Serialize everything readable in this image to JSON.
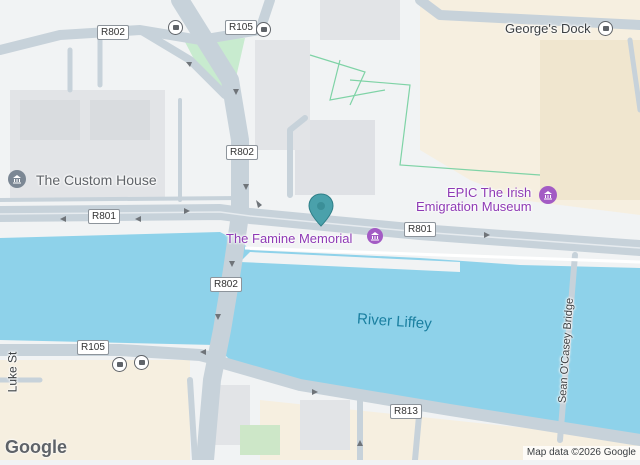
{
  "water": {
    "name": "River Liffey"
  },
  "places": {
    "custom_house": "The Custom House",
    "famine_memorial": "The Famine Memorial",
    "epic_line1": "EPIC The Irish",
    "epic_line2": "Emigration Museum",
    "georges_dock": "George's Dock"
  },
  "streets": {
    "luke_st": "Luke St",
    "sean_ocasey_bridge": "Sean O'Casey Bridge"
  },
  "shields": {
    "r105_top": "R105",
    "r802_top": "R802",
    "r802_mid": "R802",
    "r801_left": "R801",
    "r801_right": "R801",
    "r802_low": "R802",
    "r105_low": "R105",
    "r813": "R813"
  },
  "attribution": {
    "logo": "Google",
    "map_data": "Map data ©2026 Google"
  },
  "colors": {
    "water": "#8ed2ea",
    "water_label": "#1a7fa0",
    "poi_label": "#8e3ab5",
    "road": "#c7d2da",
    "pin": "#4aa1ab"
  }
}
